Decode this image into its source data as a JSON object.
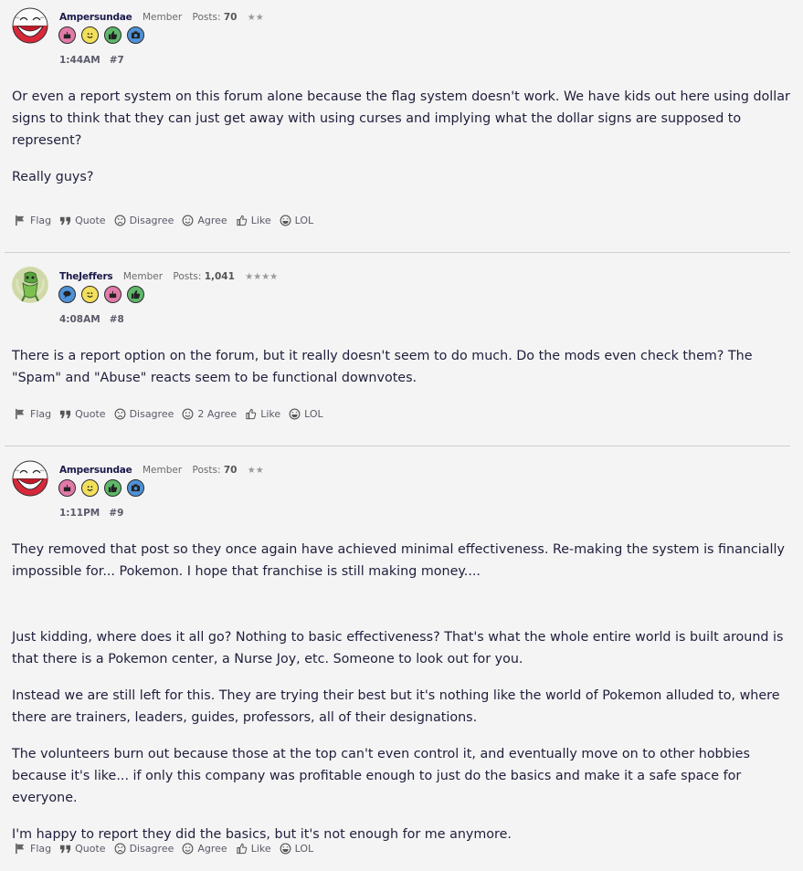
{
  "posts": [
    {
      "username": "Ampersundae",
      "role": "Member",
      "posts_label": "Posts:",
      "posts_count": "70",
      "stars": "★★",
      "badges": [
        "cake-badge-icon",
        "smiley-badge-icon",
        "thumbs-up-badge-icon",
        "camera-badge-icon"
      ],
      "time": "1:44AM",
      "post_number": "#7",
      "paragraphs": [
        "Or even a report system on this forum alone because the flag system doesn't work. We have kids out here using dollar signs to think that they can just get away with using curses and implying what the dollar signs are supposed to represent?",
        "Really guys?"
      ],
      "actions": {
        "flag": "Flag",
        "quote": "Quote",
        "disagree": "Disagree",
        "agree": "Agree",
        "like": "Like",
        "lol": "LOL"
      }
    },
    {
      "username": "TheJeffers",
      "role": "Member",
      "posts_label": "Posts:",
      "posts_count": "1,041",
      "stars": "★★★★",
      "badges": [
        "speech-bubble-badge-icon",
        "wink-badge-icon",
        "cake-badge-icon",
        "thumbs-up-badge-icon"
      ],
      "time": "4:08AM",
      "post_number": "#8",
      "paragraphs": [
        "There is a report option on the forum, but it really doesn't seem to do much. Do the mods even check them? The \"Spam\" and \"Abuse\" reacts seem to be functional downvotes."
      ],
      "actions": {
        "flag": "Flag",
        "quote": "Quote",
        "disagree": "Disagree",
        "agree": "2 Agree",
        "like": "Like",
        "lol": "LOL"
      }
    },
    {
      "username": "Ampersundae",
      "role": "Member",
      "posts_label": "Posts:",
      "posts_count": "70",
      "stars": "★★",
      "badges": [
        "cake-badge-icon",
        "smiley-badge-icon",
        "thumbs-up-badge-icon",
        "camera-badge-icon"
      ],
      "time": "1:11PM",
      "post_number": "#9",
      "paragraphs": [
        "They removed that post so they once again have achieved minimal effectiveness. Re-making the system is financially impossible for... Pokemon. I hope that franchise is still making money....",
        "Just kidding, where does it all go? Nothing to basic effectiveness? That's what the whole entire world is built around is that there is a Pokemon center, a Nurse Joy, etc. Someone to look out for you.",
        "Instead we are still left for this. They are trying their best but it's nothing like the world of Pokemon alluded to, where there are trainers, leaders, guides, professors, all of their designations.",
        "The volunteers burn out because those at the top can't even control it, and eventually move on to other hobbies because it's like... if only this company was profitable enough to just do the basics and make it a safe space for everyone.",
        "I'm happy to report they did the basics, but it's not enough for me anymore."
      ],
      "actions": {
        "flag": "Flag",
        "quote": "Quote",
        "disagree": "Disagree",
        "agree": "Agree",
        "like": "Like",
        "lol": "LOL"
      }
    }
  ],
  "colors": {
    "text": "#1e1e3c",
    "muted": "#6a6a6a",
    "divider": "#cfcfcf",
    "background": "#f4f4f4"
  }
}
